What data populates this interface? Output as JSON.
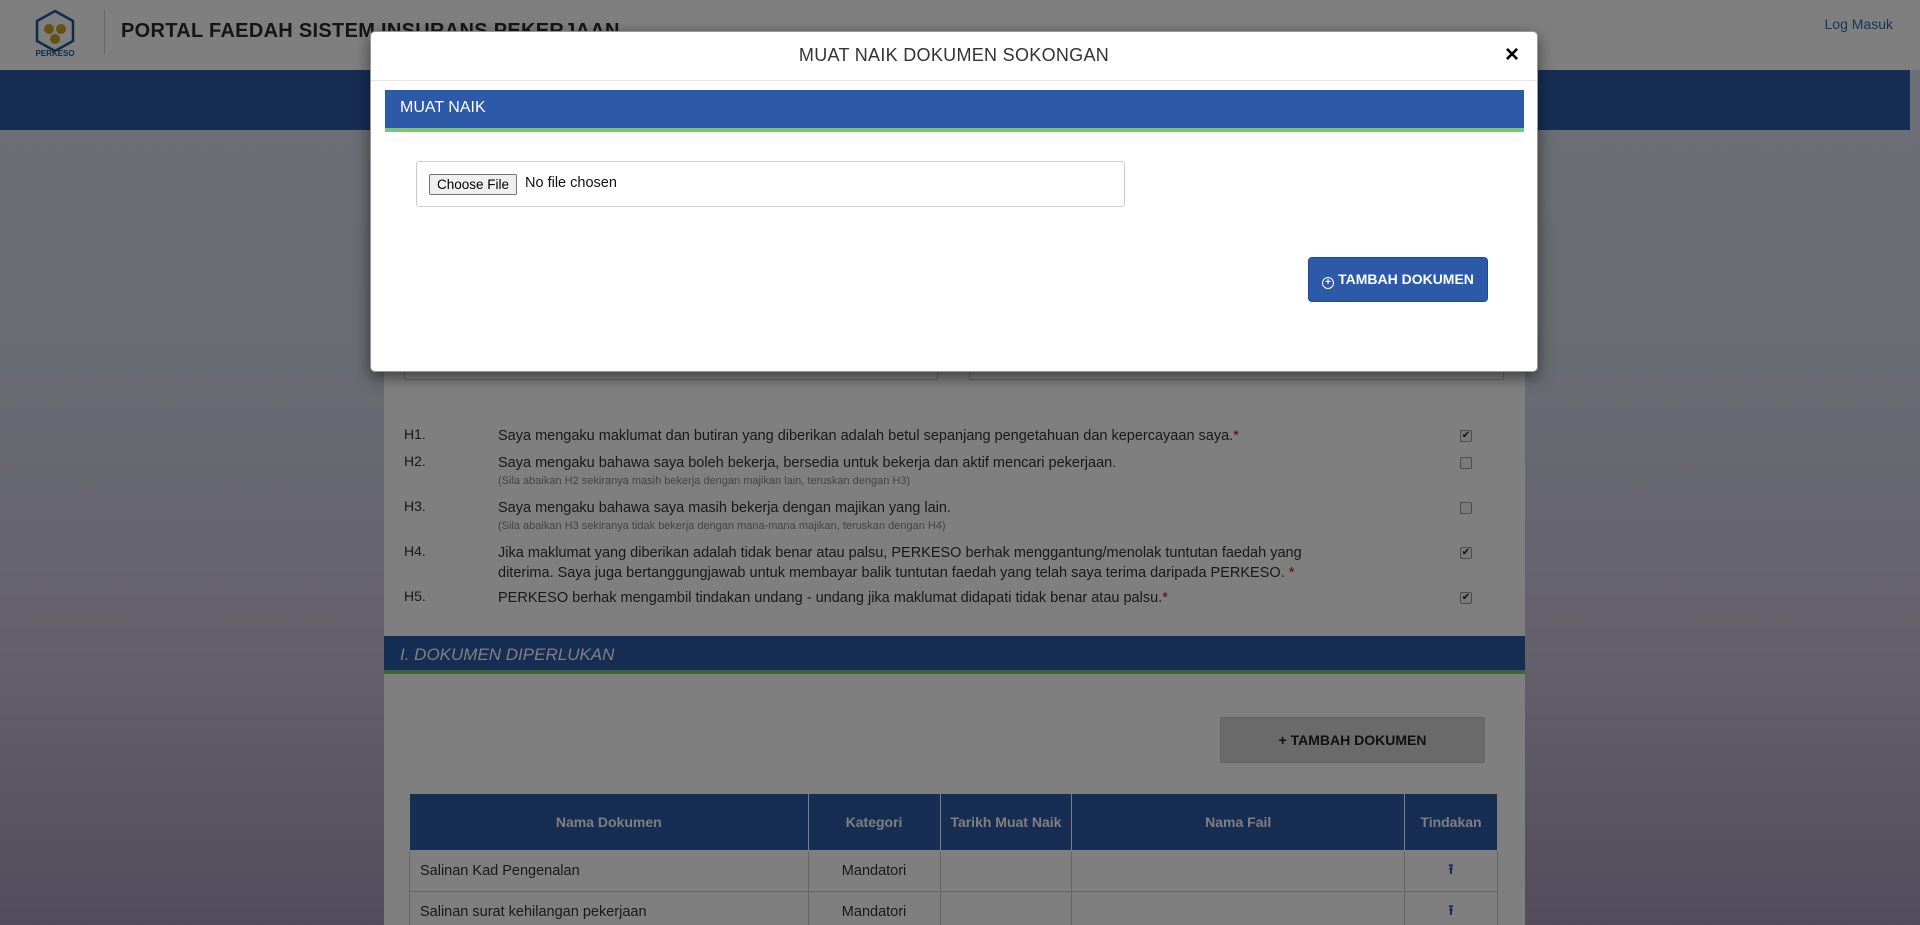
{
  "header": {
    "logo_text": "PERKESO",
    "portal_title": "PORTAL FAEDAH SISTEM INSURANS PEKERJAAN",
    "login_link": "Log Masuk"
  },
  "declarations": [
    {
      "code": "H1.",
      "text": "Saya mengaku maklumat dan butiran yang diberikan adalah betul sepanjang pengetahuan dan kepercayaan saya.",
      "required": "*",
      "note": "",
      "checked": true
    },
    {
      "code": "H2.",
      "text": "Saya mengaku bahawa saya boleh bekerja, bersedia untuk bekerja dan aktif mencari pekerjaan.",
      "required": "",
      "note": "(Sila abaikan H2 sekiranya masih bekerja dengan majikan lain, teruskan dengan H3)",
      "checked": false
    },
    {
      "code": "H3.",
      "text": "Saya mengaku bahawa saya masih bekerja dengan majikan yang lain.",
      "required": "",
      "note": "(Sila abaikan H3 sekiranya tidak bekerja dengan mana-mana majikan, teruskan dengan H4)",
      "checked": false
    },
    {
      "code": "H4.",
      "text": "Jika maklumat yang diberikan adalah tidak benar atau palsu, PERKESO berhak menggantung/menolak tuntutan faedah yang diterima. Saya juga bertanggungjawab untuk membayar balik tuntutan faedah yang telah saya terima daripada PERKESO.",
      "required": " *",
      "note": "",
      "checked": true
    },
    {
      "code": "H5.",
      "text": "PERKESO berhak mengambil tindakan undang - undang jika maklumat didapati tidak benar atau palsu.",
      "required": "*",
      "note": "",
      "checked": true
    }
  ],
  "documents_section": {
    "title": "I. DOKUMEN DIPERLUKAN",
    "add_button": "TAMBAH DOKUMEN",
    "columns": [
      "Nama Dokumen",
      "Kategori",
      "Tarikh Muat Naik",
      "Nama Fail",
      "Tindakan"
    ],
    "rows": [
      {
        "name": "Salinan Kad Pengenalan",
        "category": "Mandatori",
        "date": "",
        "file": ""
      },
      {
        "name": "Salinan surat kehilangan pekerjaan",
        "category": "Mandatori",
        "date": "",
        "file": ""
      }
    ]
  },
  "modal": {
    "title": "MUAT NAIK DOKUMEN SOKONGAN",
    "close_icon": "×",
    "upload_header": "MUAT NAIK",
    "choose_file_label": "Choose File",
    "file_status": "No file chosen",
    "add_button": "TAMBAH DOKUMEN"
  },
  "colors": {
    "primary": "#2c5aa8",
    "accent_green": "#7cc576",
    "required": "#d0021b"
  }
}
